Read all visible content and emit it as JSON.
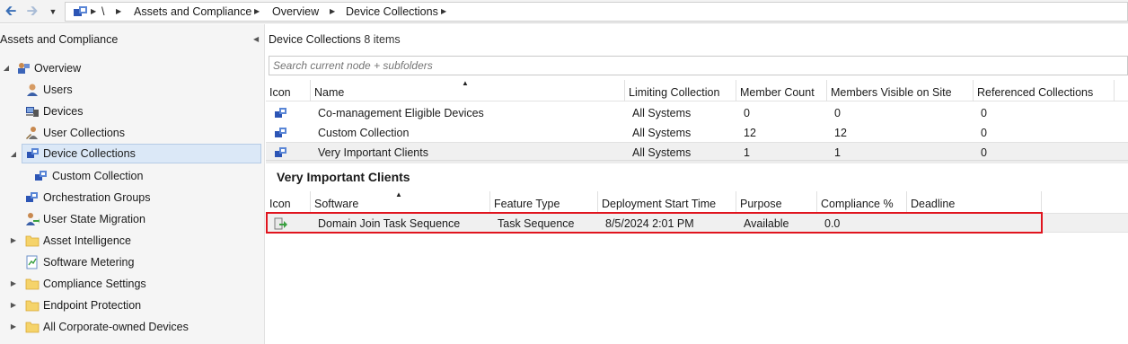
{
  "breadcrumb": {
    "root": "\\",
    "items": [
      "Assets and Compliance",
      "Overview",
      "Device Collections"
    ]
  },
  "tree": {
    "header": "Assets and Compliance",
    "nodes": [
      {
        "label": "Overview",
        "icon": "overview-icon"
      },
      {
        "label": "Users",
        "icon": "user-icon"
      },
      {
        "label": "Devices",
        "icon": "devices-icon"
      },
      {
        "label": "User Collections",
        "icon": "user-collection-icon"
      },
      {
        "label": "Device Collections",
        "icon": "device-collection-icon"
      },
      {
        "label": "Custom Collection",
        "icon": "device-collection-icon"
      },
      {
        "label": "Orchestration Groups",
        "icon": "orchestration-icon"
      },
      {
        "label": "User State Migration",
        "icon": "user-migration-icon"
      },
      {
        "label": "Asset Intelligence",
        "icon": "folder-icon"
      },
      {
        "label": "Software Metering",
        "icon": "metering-icon"
      },
      {
        "label": "Compliance Settings",
        "icon": "folder-icon"
      },
      {
        "label": "Endpoint Protection",
        "icon": "folder-icon"
      },
      {
        "label": "All Corporate-owned Devices",
        "icon": "folder-icon"
      }
    ]
  },
  "list": {
    "title": "Device Collections",
    "count": "8 items",
    "search_placeholder": "Search current node + subfolders",
    "columns": [
      "Icon",
      "Name",
      "Limiting Collection",
      "Member Count",
      "Members Visible on Site",
      "Referenced Collections"
    ],
    "rows": [
      {
        "name": "Co-management Eligible Devices",
        "limiting": "All Systems",
        "members": "0",
        "visible": "0",
        "referenced": "0"
      },
      {
        "name": "Custom Collection",
        "limiting": "All Systems",
        "members": "12",
        "visible": "12",
        "referenced": "0"
      },
      {
        "name": "Very Important Clients",
        "limiting": "All Systems",
        "members": "1",
        "visible": "1",
        "referenced": "0"
      }
    ]
  },
  "detail": {
    "title": "Very Important Clients",
    "columns": [
      "Icon",
      "Software",
      "Feature Type",
      "Deployment Start Time",
      "Purpose",
      "Compliance %",
      "Deadline"
    ],
    "rows": [
      {
        "software": "Domain Join Task Sequence",
        "feature_type": "Task Sequence",
        "start_time": "8/5/2024 2:01 PM",
        "purpose": "Available",
        "compliance": "0.0",
        "deadline": ""
      }
    ]
  },
  "colors": {
    "highlight": "#e0141e",
    "selection": "#dbe8f7"
  }
}
